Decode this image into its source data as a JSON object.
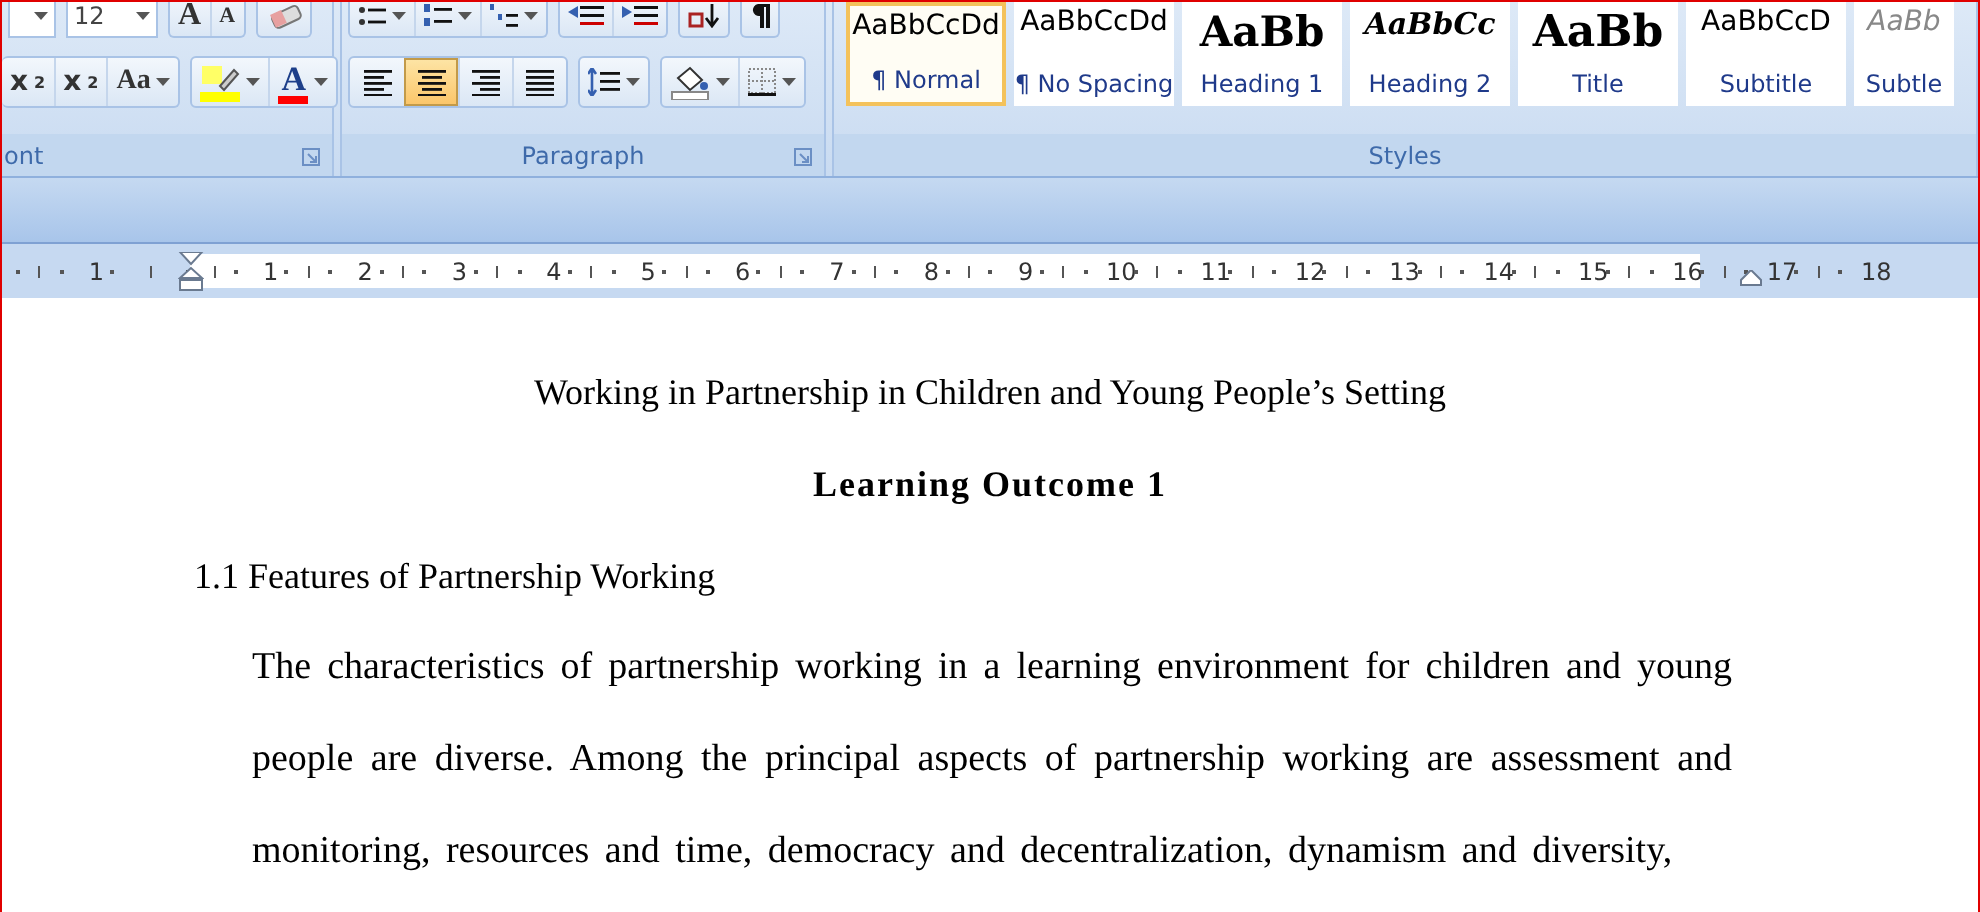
{
  "ribbon": {
    "font_group": {
      "label": "ont",
      "font_size": "12",
      "grow_glyph": "A",
      "shrink_glyph": "A",
      "subscript_glyph": "x",
      "subscript_mark": "2",
      "superscript_glyph": "x",
      "superscript_mark": "2",
      "case_glyph": "Aa",
      "color_glyph": "A"
    },
    "paragraph_group": {
      "label": "Paragraph",
      "alignments": [
        {
          "kind": "left",
          "selected": false
        },
        {
          "kind": "center",
          "selected": true
        },
        {
          "kind": "right",
          "selected": false
        },
        {
          "kind": "justify",
          "selected": false
        }
      ]
    },
    "styles_group": {
      "label": "Styles",
      "styles": [
        {
          "kind": "normal",
          "preview": "AaBbCcDd",
          "name": "¶ Normal",
          "selected": true
        },
        {
          "kind": "nospacing",
          "preview": "AaBbCcDd",
          "name": "¶ No Spacing",
          "selected": false
        },
        {
          "kind": "heading1",
          "preview": "AaBb",
          "name": "Heading 1",
          "selected": false
        },
        {
          "kind": "heading2",
          "preview": "AaBbCc",
          "name": "Heading 2",
          "selected": false
        },
        {
          "kind": "title",
          "preview": "AaBb",
          "name": "Title",
          "selected": false
        },
        {
          "kind": "subtitle",
          "preview": "AaBbCcD",
          "name": "Subtitle",
          "selected": false
        },
        {
          "kind": "subtle",
          "preview": "AaBb",
          "name": "Subtle",
          "selected": false
        }
      ]
    }
  },
  "ruler": {
    "left_labels": [
      "1"
    ],
    "labels": [
      "1",
      "2",
      "3",
      "4",
      "5",
      "6",
      "7",
      "8",
      "9",
      "10",
      "11",
      "12",
      "13",
      "14",
      "15",
      "16"
    ],
    "right_labels": [
      "17",
      "18"
    ]
  },
  "document": {
    "blocks": [
      {
        "kind": "title",
        "text": "Working in Partnership in Children and Young People’s Setting"
      },
      {
        "kind": "heading",
        "text": "Learning Outcome 1"
      },
      {
        "kind": "subheading",
        "text": "1.1 Features of Partnership Working"
      },
      {
        "kind": "paragraph",
        "text": "The characteristics of partnership working in a learning environment for children and young people are diverse. Among the principal aspects of partnership working are assessment and monitoring, resources and time, democracy and decentralization, dynamism and diversity,"
      }
    ]
  }
}
